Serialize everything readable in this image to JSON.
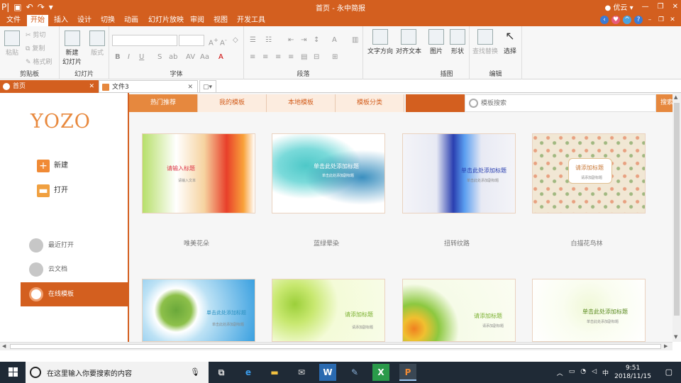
{
  "app": {
    "title": "首页 - 永中简报",
    "cloud_label": "优云",
    "accent": "#d35f1f"
  },
  "menu": {
    "tabs": [
      "文件",
      "开始",
      "插入",
      "设计",
      "切换",
      "动画",
      "幻灯片放映",
      "审阅",
      "视图",
      "开发工具"
    ],
    "active_index": 1
  },
  "ribbon": {
    "clipboard": {
      "paste": "粘贴",
      "cut": "剪切",
      "copy": "复制",
      "format_painter": "格式刷",
      "group": "剪贴板"
    },
    "slides": {
      "new_slide": "新建",
      "new_slide2": "幻灯片",
      "layout": "版式",
      "group": "幻灯片"
    },
    "font": {
      "group": "字体",
      "bold": "B",
      "italic": "I",
      "underline": "U",
      "strike": "S"
    },
    "paragraph": {
      "group": "段落"
    },
    "text": {
      "direction": "文字方向",
      "align": "对齐文本"
    },
    "insert": {
      "picture": "图片",
      "shape": "形状",
      "group": "插图"
    },
    "edit": {
      "find_replace": "查找替换",
      "select": "选择",
      "group": "编辑"
    }
  },
  "doc_tabs": [
    {
      "label": "首页",
      "active": true
    },
    {
      "label": "文件3",
      "active": false
    }
  ],
  "left": {
    "logo": "YOZO",
    "new": "新建",
    "open": "打开",
    "nav": [
      "最近打开",
      "云文档",
      "在线模板"
    ],
    "active_nav": 2
  },
  "content": {
    "tabs": [
      "热门推荐",
      "我的模板",
      "本地模板",
      "模板分类"
    ],
    "active_tab": 0,
    "search_placeholder": "模板搜索",
    "search_button": "搜索"
  },
  "templates": [
    {
      "name": "唯美花朵",
      "title": "请输入标题",
      "subtitle": "请输入文本"
    },
    {
      "name": "蓝绿晕染",
      "title": "单击此处添加标题",
      "subtitle": "单击此处添加副标题"
    },
    {
      "name": "扭转纹路",
      "title": "单击此处添加标题",
      "subtitle": "单击此处添加副标题"
    },
    {
      "name": "白描花鸟林",
      "title": "请添加标题",
      "subtitle": "请添加副标题"
    },
    {
      "name": "",
      "title": "单击此处添加标题",
      "subtitle": "单击此处添加副标题"
    },
    {
      "name": "",
      "title": "请添加标题",
      "subtitle": "请添加副标题"
    },
    {
      "name": "",
      "title": "请添加标题",
      "subtitle": "请添加副标题"
    },
    {
      "name": "",
      "title": "单击此处添加标题",
      "subtitle": "单击此处添加副标题"
    }
  ],
  "taskbar": {
    "search_text": "在这里输入你要搜索的内容",
    "time": "9:51",
    "date": "2018/11/15",
    "ime": "中"
  }
}
